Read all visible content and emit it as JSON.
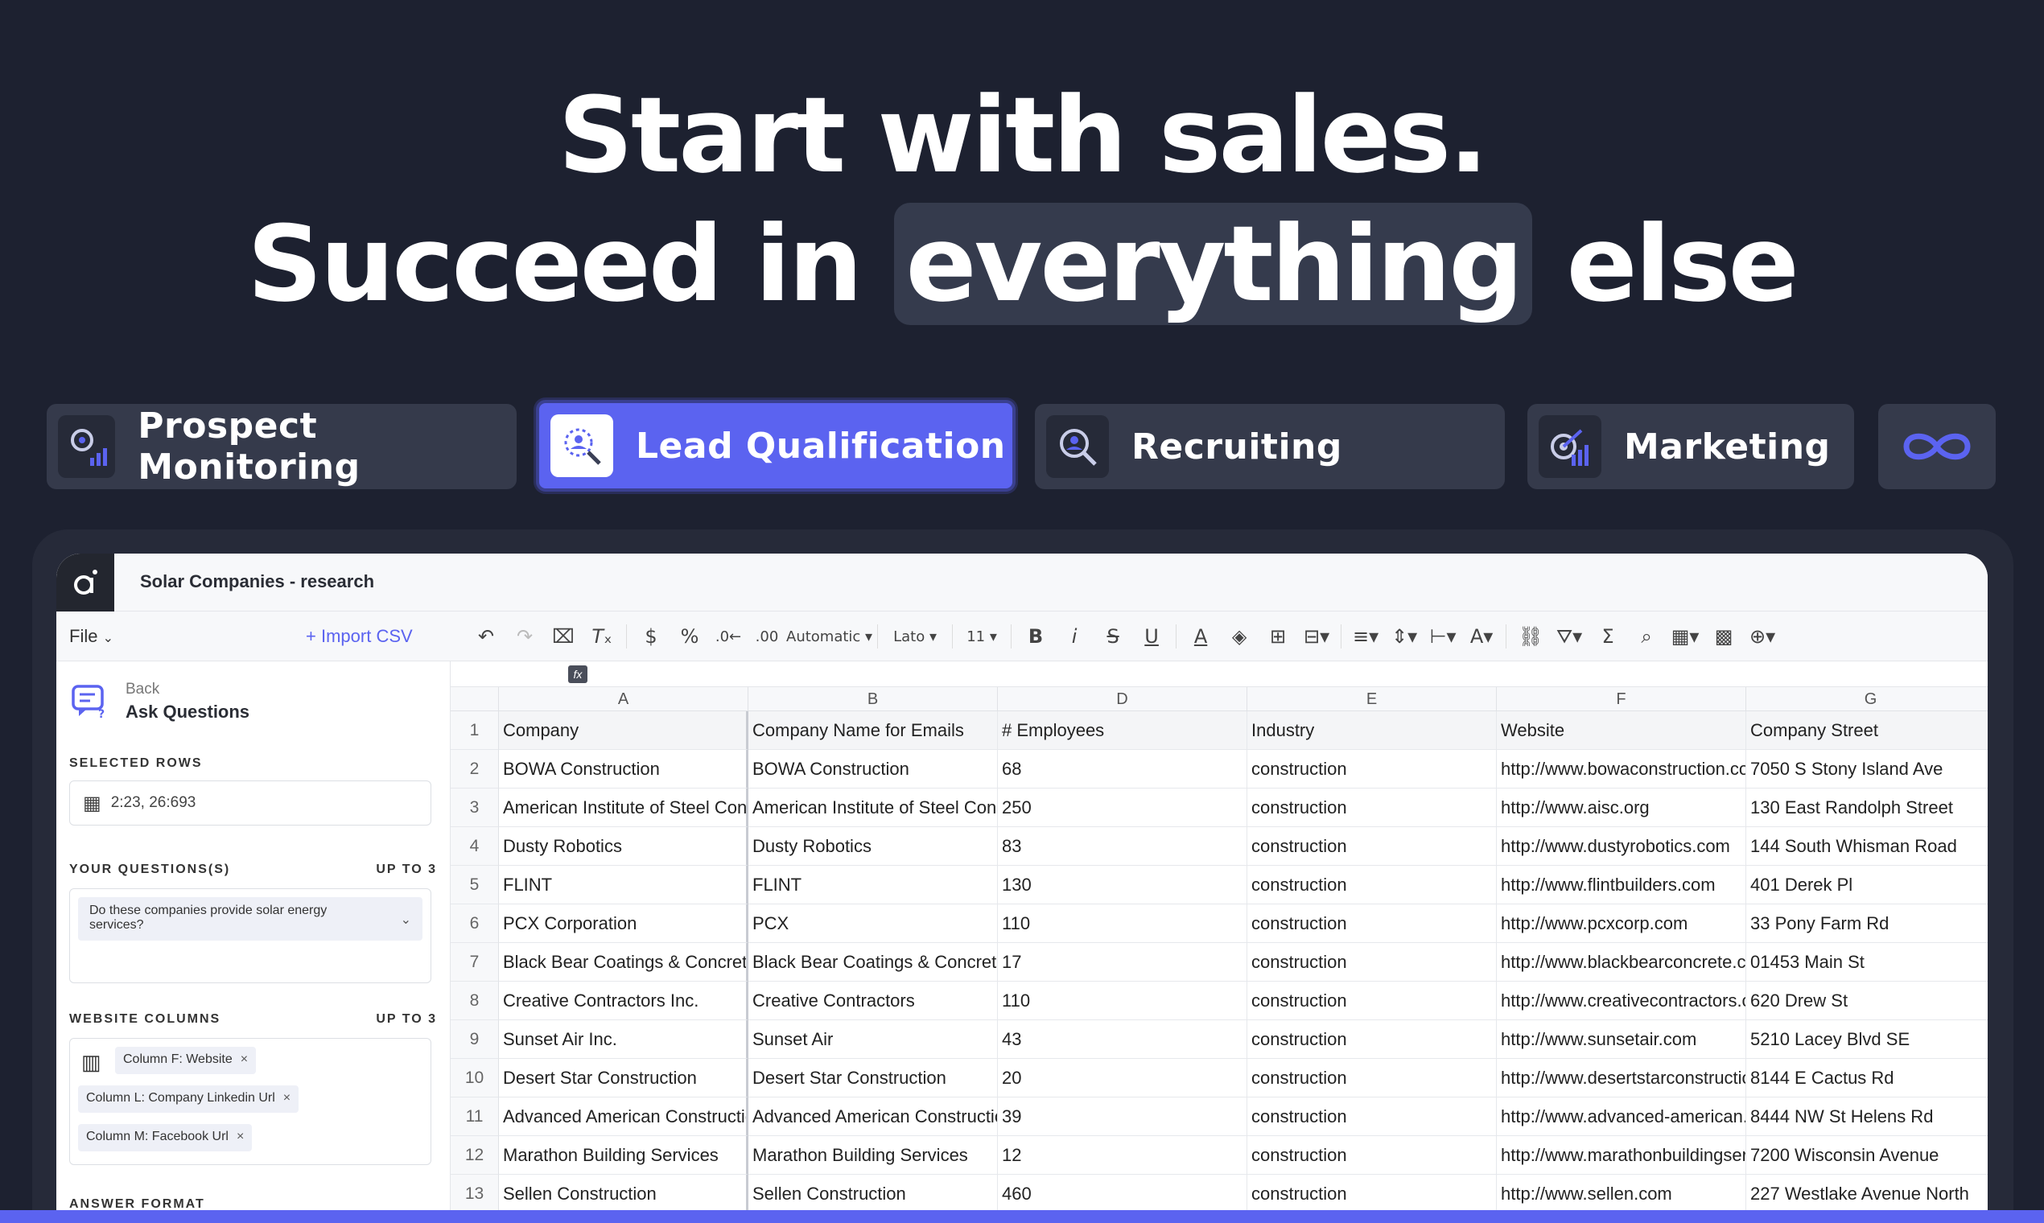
{
  "hero": {
    "line1": "Start with sales.",
    "line2_before": "Succeed in",
    "line2_highlight": "everything",
    "line2_after": "else"
  },
  "tabs": [
    {
      "label": "Prospect Monitoring",
      "icon": "prospect-monitoring-icon"
    },
    {
      "label": "Lead Qualification",
      "icon": "lead-qualification-icon"
    },
    {
      "label": "Recruiting",
      "icon": "recruiting-icon"
    },
    {
      "label": "Marketing",
      "icon": "marketing-icon"
    },
    {
      "label": "",
      "icon": "infinity-icon"
    }
  ],
  "app": {
    "doc_title": "Solar Companies - research",
    "file_menu": "File",
    "import_csv": "Import CSV",
    "toolbar": {
      "format": "Automatic",
      "font": "Lato",
      "size": "11"
    },
    "sidebar": {
      "back_small": "Back",
      "back_big": "Ask Questions",
      "selected_rows_label": "SELECTED ROWS",
      "selected_rows_value": "2:23, 26:693",
      "questions_label": "YOUR QUESTIONS(S)",
      "questions_limit": "UP TO 3",
      "question_text": "Do these companies provide solar energy services?",
      "website_label": "WEBSITE COLUMNS",
      "website_limit": "UP TO 3",
      "chips": [
        "Column F: Website",
        "Column L: Company Linkedin Url",
        "Column M: Facebook Url"
      ],
      "answer_label": "ANSWER FORMAT"
    },
    "grid": {
      "columns": [
        "A",
        "B",
        "D",
        "E",
        "F",
        "G"
      ],
      "headers": [
        "Company",
        "Company Name for Emails",
        "# Employees",
        "Industry",
        "Website",
        "Company Street"
      ],
      "rows": [
        [
          "2",
          "BOWA Construction",
          "BOWA Construction",
          "68",
          "construction",
          "http://www.bowaconstruction.com",
          "7050 S Stony Island Ave"
        ],
        [
          "3",
          "American Institute of Steel Construction",
          "American Institute of Steel Construction",
          "250",
          "construction",
          "http://www.aisc.org",
          "130 East Randolph Street"
        ],
        [
          "4",
          "Dusty Robotics",
          "Dusty Robotics",
          "83",
          "construction",
          "http://www.dustyrobotics.com",
          "144 South Whisman Road"
        ],
        [
          "5",
          "FLINT",
          "FLINT",
          "130",
          "construction",
          "http://www.flintbuilders.com",
          "401 Derek Pl"
        ],
        [
          "6",
          "PCX Corporation",
          "PCX",
          "110",
          "construction",
          "http://www.pcxcorp.com",
          "33 Pony Farm Rd"
        ],
        [
          "7",
          "Black Bear Coatings & Concrete",
          "Black Bear Coatings & Concrete",
          "17",
          "construction",
          "http://www.blackbearconcrete.com",
          "01453 Main St"
        ],
        [
          "8",
          "Creative Contractors Inc.",
          "Creative Contractors",
          "110",
          "construction",
          "http://www.creativecontractors.com",
          "620 Drew St"
        ],
        [
          "9",
          "Sunset Air Inc.",
          "Sunset Air",
          "43",
          "construction",
          "http://www.sunsetair.com",
          "5210 Lacey Blvd SE"
        ],
        [
          "10",
          "Desert Star Construction",
          "Desert Star Construction",
          "20",
          "construction",
          "http://www.desertstarconstruction.com",
          "8144 E Cactus Rd"
        ],
        [
          "11",
          "Advanced American Construction",
          "Advanced American Construction",
          "39",
          "construction",
          "http://www.advanced-american.com",
          "8444 NW St Helens Rd"
        ],
        [
          "12",
          "Marathon Building Services",
          "Marathon Building Services",
          "12",
          "construction",
          "http://www.marathonbuildingservices.com",
          "7200 Wisconsin Avenue"
        ],
        [
          "13",
          "Sellen Construction",
          "Sellen Construction",
          "460",
          "construction",
          "http://www.sellen.com",
          "227 Westlake Avenue North"
        ]
      ]
    }
  },
  "colors": {
    "background": "#1d2130",
    "accent": "#5b63f0",
    "tab": "#353a4b"
  }
}
